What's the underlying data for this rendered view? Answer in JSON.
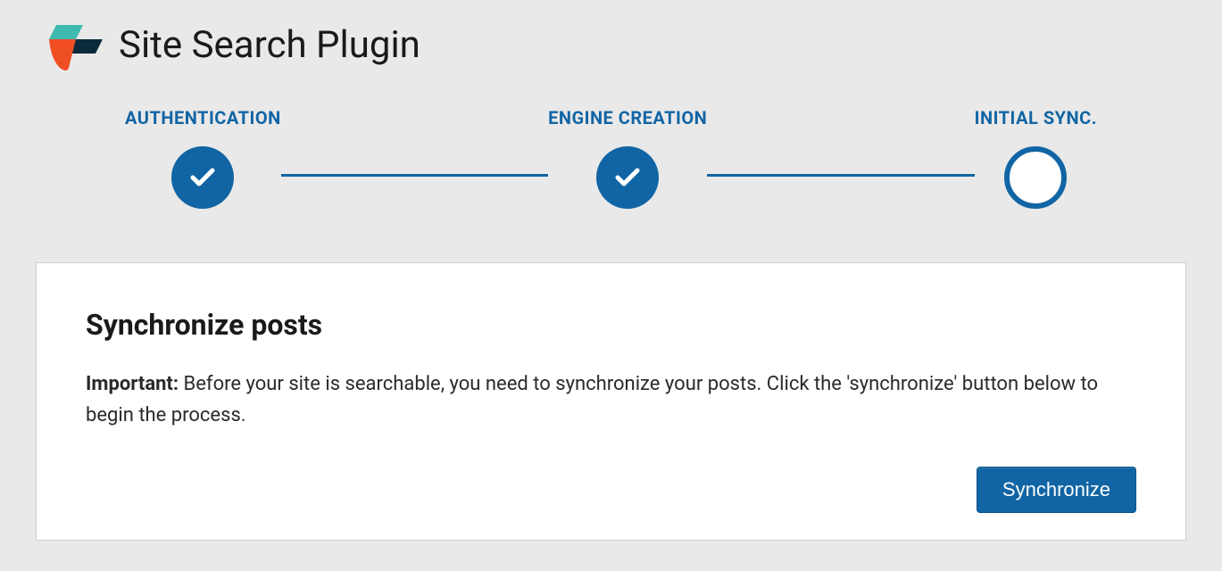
{
  "header": {
    "title": "Site Search Plugin"
  },
  "progress": {
    "steps": [
      {
        "label": "AUTHENTICATION",
        "state": "completed"
      },
      {
        "label": "ENGINE CREATION",
        "state": "completed"
      },
      {
        "label": "INITIAL SYNC.",
        "state": "current"
      }
    ]
  },
  "card": {
    "title": "Synchronize posts",
    "important_label": "Important:",
    "body_text": "Before your site is searchable, you need to synchronize your posts. Click the 'synchronize' button below to begin the process.",
    "button_label": "Synchronize"
  },
  "colors": {
    "accent": "#1165a4",
    "logo_teal": "#3ebab0",
    "logo_orange": "#f04e23",
    "logo_dark": "#0b2b3b"
  }
}
